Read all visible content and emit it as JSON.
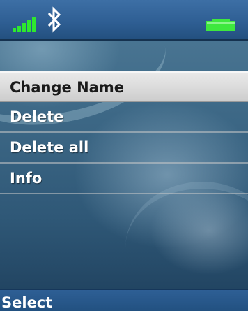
{
  "status": {
    "signal_icon": "signal-strength-icon",
    "bluetooth_icon": "bluetooth-icon",
    "battery_icon": "battery-icon",
    "signal_level": 1.0,
    "battery_level": 1.0,
    "colors": {
      "signal": "#2ee82e",
      "battery": "#3ee83e",
      "bluetooth": "#ffffff"
    }
  },
  "menu": {
    "items": [
      {
        "label": "Change Name"
      },
      {
        "label": "Delete"
      },
      {
        "label": "Delete all"
      },
      {
        "label": "Info"
      }
    ],
    "selected_label": "Change Name"
  },
  "softkeys": {
    "left": "Select"
  }
}
